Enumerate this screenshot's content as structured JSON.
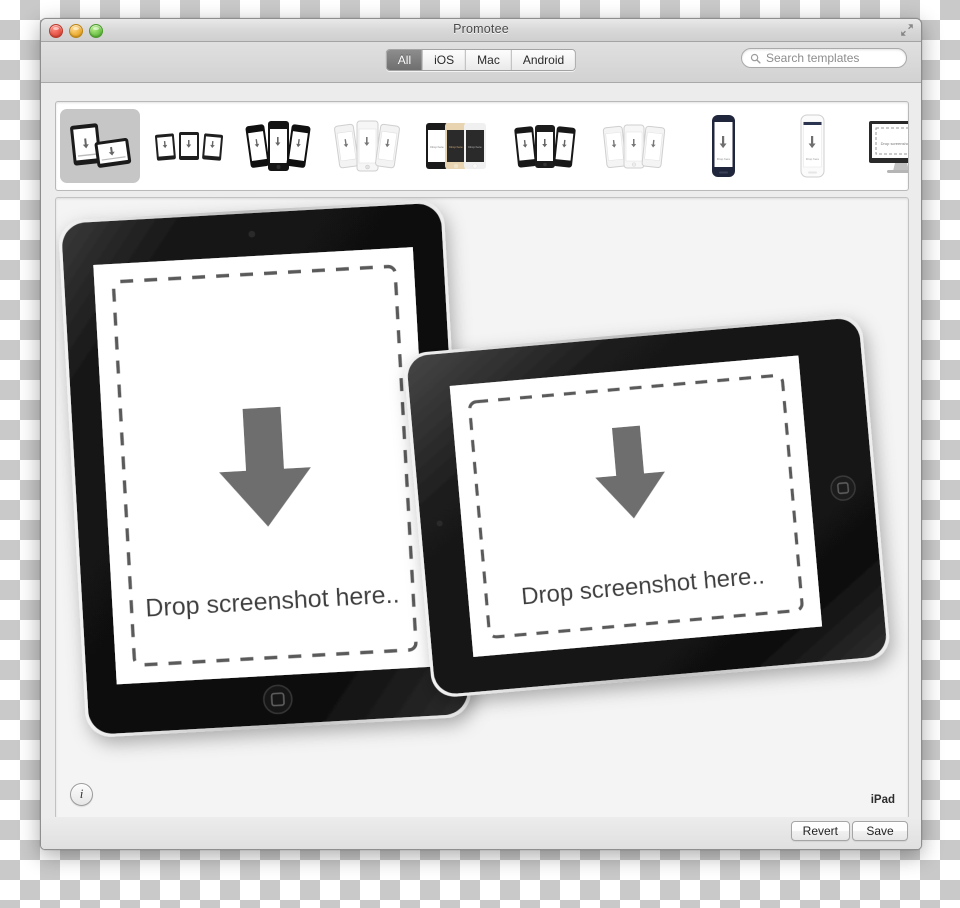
{
  "window": {
    "title": "Promotee",
    "controls": {
      "close": "close-button",
      "minimize": "minimize-button",
      "zoom": "zoom-button",
      "fullscreen": "fullscreen-button"
    }
  },
  "toolbar": {
    "filters": [
      {
        "label": "All",
        "active": true
      },
      {
        "label": "iOS",
        "active": false
      },
      {
        "label": "Mac",
        "active": false
      },
      {
        "label": "Android",
        "active": false
      }
    ],
    "search": {
      "placeholder": "Search templates",
      "value": "",
      "icon": "search-icon"
    }
  },
  "templates": {
    "items": [
      {
        "name": "ipad-pair",
        "kind": "ipad-pair",
        "selected": true
      },
      {
        "name": "ipad-trio-black",
        "kind": "ipad-trio",
        "selected": false
      },
      {
        "name": "iphone-trio-black",
        "kind": "iphone-trio-dk",
        "selected": false
      },
      {
        "name": "iphone-trio-white",
        "kind": "iphone-trio-lt",
        "selected": false
      },
      {
        "name": "iphone-5s-colors",
        "kind": "iphone-colors",
        "selected": false
      },
      {
        "name": "iphone-4-trio-black",
        "kind": "iphone4-dk",
        "selected": false
      },
      {
        "name": "iphone-4-trio-white",
        "kind": "iphone4-lt",
        "selected": false
      },
      {
        "name": "galaxy-dark",
        "kind": "galaxy-dk",
        "selected": false
      },
      {
        "name": "galaxy-white",
        "kind": "galaxy-lt",
        "selected": false
      },
      {
        "name": "imac-display",
        "kind": "imac",
        "selected": false
      }
    ]
  },
  "canvas": {
    "dropzone_text": "Drop screenshot here..",
    "arrow_icon": "down-arrow-icon",
    "devices": [
      {
        "name": "ipad-portrait",
        "orientation": "portrait",
        "bezel": "black"
      },
      {
        "name": "ipad-landscape",
        "orientation": "landscape",
        "bezel": "black"
      }
    ],
    "info_button_label": "i",
    "device_label": "iPad"
  },
  "footer": {
    "revert_label": "Revert",
    "save_label": "Save"
  },
  "colors": {
    "window_bg": "#ececec",
    "canvas_bg": "#f4f4f4",
    "selected_thumb": "#c6c6c6",
    "accent_segment": "#7d7d7d",
    "dropzone_gray": "#6b6b6b"
  }
}
